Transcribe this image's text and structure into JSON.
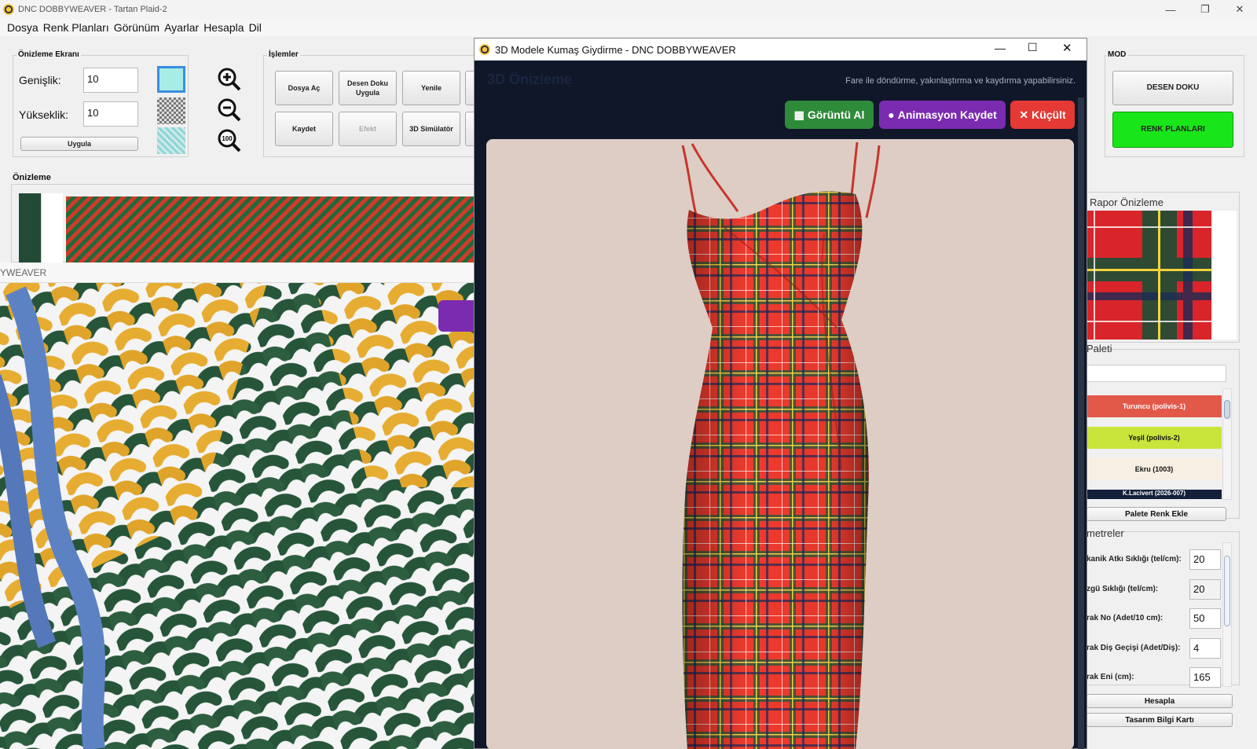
{
  "app": {
    "title": "DNC DOBBYWEAVER - Tartan Plaid-2",
    "menu": [
      "Dosya",
      "Renk Planları",
      "Görünüm",
      "Ayarlar",
      "Hesapla",
      "Dil"
    ]
  },
  "preview_screen": {
    "title": "Önizleme Ekranı",
    "width_label": "Genişlik:",
    "width_value": "10",
    "height_label": "Yükseklik:",
    "height_value": "10",
    "apply_label": "Uygula"
  },
  "operations": {
    "title": "İşlemler",
    "open": "Dosya Aç",
    "apply_pattern": "Desen Doku Uygula",
    "refresh": "Yenile",
    "save": "Kaydet",
    "effect": "Efekt",
    "simulator": "3D Simülatör"
  },
  "preview_label": "Önizleme",
  "weave_window_title": "YWEAVER",
  "mode": {
    "title": "MOD",
    "pattern_button": "DESEN DOKU",
    "color_plans_button": "RENK PLANLARI"
  },
  "dialog": {
    "title": "3D Modele Kumaş Giydirme - DNC DOBBYWEAVER",
    "heading": "3D Önizleme",
    "hint": "Fare ile döndürme, yakınlaştırma ve kaydırma yapabilirsiniz.",
    "screenshot": "Görüntü Al",
    "record": "Animasyon Kaydet",
    "shrink": "Küçült"
  },
  "report_preview_title": "Rapor Önizleme",
  "palette": {
    "title": "Paleti",
    "items": [
      {
        "label": "Turuncu (polivis-1)",
        "color": "#e2594a",
        "text": "#ffffff"
      },
      {
        "label": "Yeşil (polivis-2)",
        "color": "#c9e43a",
        "text": "#1a1a1a"
      },
      {
        "label": "Ekru (1003)",
        "color": "#f8efe3",
        "text": "#1a1a1a"
      },
      {
        "label": "K.Lacivert (2026-007)",
        "color": "#14203a",
        "text": "#ffffff"
      }
    ],
    "add_button": "Palete Renk Ekle"
  },
  "parameters": {
    "title": "metreler",
    "rows": [
      {
        "label": "kanik Atkı Sıklığı (tel/cm):",
        "value": "20"
      },
      {
        "label": "zgü Sıklığı (tel/cm):",
        "value": "20"
      },
      {
        "label": "rak No (Adet/10 cm):",
        "value": "50"
      },
      {
        "label": "rak Diş Geçişi (Adet/Diş):",
        "value": "4"
      },
      {
        "label": "rak Eni (cm):",
        "value": "165"
      }
    ],
    "calc_button": "Hesapla",
    "card_button": "Tasarım Bilgi Kartı"
  },
  "colors": {
    "accent_green": "#2e8b3a",
    "accent_purple": "#7b2bb0",
    "accent_red": "#e53935",
    "mode_green": "#19e619"
  }
}
